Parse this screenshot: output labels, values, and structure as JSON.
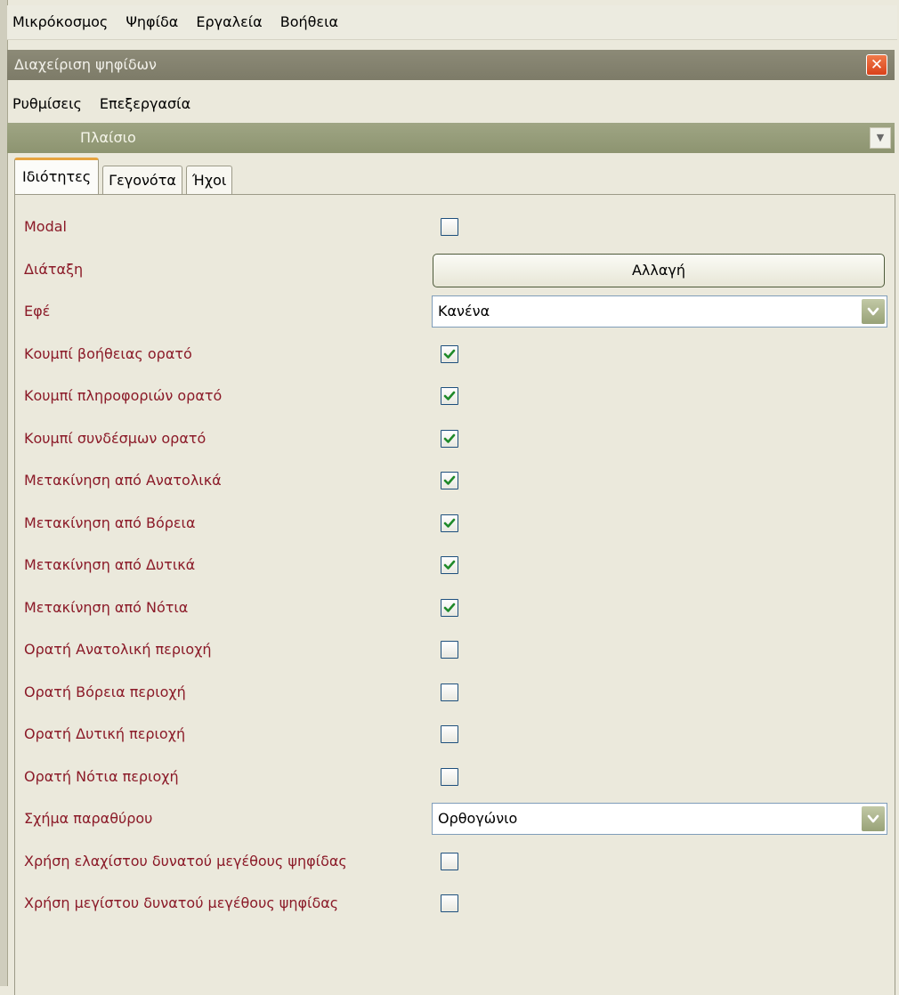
{
  "menu": [
    "Μικρόκοσμος",
    "Ψηφίδα",
    "Εργαλεία",
    "Βοήθεια"
  ],
  "window_title": "Διαχείριση ψηφίδων",
  "submenu": [
    "Ρυθμίσεις",
    "Επεξεργασία"
  ],
  "section_title": "Πλαίσιο",
  "tabs": [
    "Ιδιότητες",
    "Γεγονότα",
    "Ήχοι"
  ],
  "active_tab": "Ιδιότητες",
  "properties": [
    {
      "label": "Modal",
      "type": "checkbox",
      "checked": false
    },
    {
      "label": "Διάταξη",
      "type": "button",
      "value": "Αλλαγή"
    },
    {
      "label": "Εφέ",
      "type": "select",
      "value": "Κανένα"
    },
    {
      "label": "Κουμπί βοήθειας ορατό",
      "type": "checkbox",
      "checked": true
    },
    {
      "label": "Κουμπί πληροφοριών ορατό",
      "type": "checkbox",
      "checked": true
    },
    {
      "label": "Κουμπί συνδέσμων ορατό",
      "type": "checkbox",
      "checked": true
    },
    {
      "label": "Μετακίνηση από Ανατολικά",
      "type": "checkbox",
      "checked": true
    },
    {
      "label": "Μετακίνηση από Βόρεια",
      "type": "checkbox",
      "checked": true
    },
    {
      "label": "Μετακίνηση από Δυτικά",
      "type": "checkbox",
      "checked": true
    },
    {
      "label": "Μετακίνηση από Νότια",
      "type": "checkbox",
      "checked": true
    },
    {
      "label": "Ορατή Ανατολική περιοχή",
      "type": "checkbox",
      "checked": false
    },
    {
      "label": "Ορατή Βόρεια περιοχή",
      "type": "checkbox",
      "checked": false
    },
    {
      "label": "Ορατή Δυτική περιοχή",
      "type": "checkbox",
      "checked": false
    },
    {
      "label": "Ορατή Νότια περιοχή",
      "type": "checkbox",
      "checked": false
    },
    {
      "label": "Σχήμα παραθύρου",
      "type": "select",
      "value": "Ορθογώνιο"
    },
    {
      "label": "Χρήση ελαχίστου δυνατού μεγέθους ψηφίδας",
      "type": "checkbox",
      "checked": false
    },
    {
      "label": "Χρήση μεγίστου δυνατού μεγέθους ψηφίδας",
      "type": "checkbox",
      "checked": false
    }
  ],
  "colors": {
    "label": "#8b1a28",
    "check": "#1f8a2a",
    "section": "#8d9470",
    "title": "#7d7b68",
    "tab_accent": "#e6a33f"
  },
  "icons": {
    "close": "close-icon",
    "section_dropdown": "chevron-down-icon",
    "check": "check-icon",
    "dropdown": "chevron-down-icon"
  }
}
